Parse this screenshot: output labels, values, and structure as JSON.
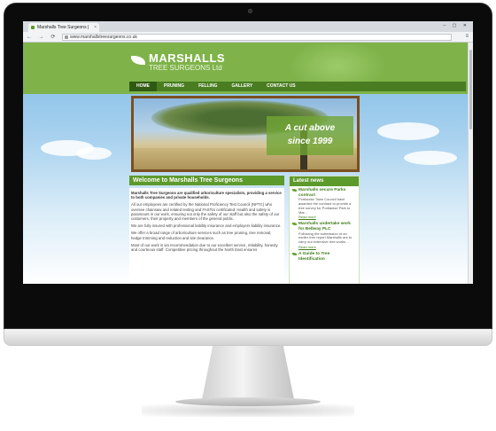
{
  "browser": {
    "tab_title": "Marshalls Tree Surgeons |",
    "tab_close": "×",
    "window_buttons": "– ▢ ✕",
    "nav_icons": "← → ⟳ ⌂",
    "url": "www.marshallstreesurgeons.co.uk",
    "menu_icon": "≡"
  },
  "site": {
    "logo_title": "MARSHALLS",
    "logo_subtitle": "TREE SURGEONS Ltd",
    "nav": [
      "HOME",
      "PRUNING",
      "FELLING",
      "GALLERY",
      "CONTACT US"
    ],
    "nav_active": "HOME",
    "hero_slogan_1": "A cut above",
    "hero_slogan_2": "since 1999",
    "welcome_title": "Welcome to Marshalls Tree Surgeons",
    "paragraphs": [
      "Marshalls Tree Surgeons are qualified arboriculture specialists, providing a service to both companies and private households.",
      "All our employees are certified by the National Proficiency Test Council (NPTC) who oversee chainsaw and related testing and FASTcs certificated: Health and safety is paramount in our work, ensuring not only the safety of our staff but also the safety of our customers, their property and members of the general public.",
      "We are fully insured with professional liability insurance and employers liability insurance.",
      "We offer a broad range of arboriculture services such as tree pruning, tree removal, hedge trimming and reduction and site clearance.",
      "Most of our work is via recommendation due to our excellent service, reliability, honesty and courteous staff. Competitive pricing throughout the North East ensures"
    ],
    "news_heading": "Latest news",
    "news": [
      {
        "title": "Marshalls secure Parks contract",
        "body": "Portlaoise Town Council have awarded the contract to provide a tree survey for Portlaoise Park to Mar...",
        "more": "Read more"
      },
      {
        "title": "Marshalls undertake work for Bellway PLC",
        "body": "Following the submission of an earlier tree report Marshalls are to carry out extensive tree works ...",
        "more": "Read more"
      },
      {
        "title": "A Guide to Tree Identification",
        "body": "",
        "more": ""
      }
    ]
  },
  "colors": {
    "brand_green": "#7fb34a",
    "nav_dark": "#4a7d22",
    "hero_frame": "#7b4f21"
  }
}
